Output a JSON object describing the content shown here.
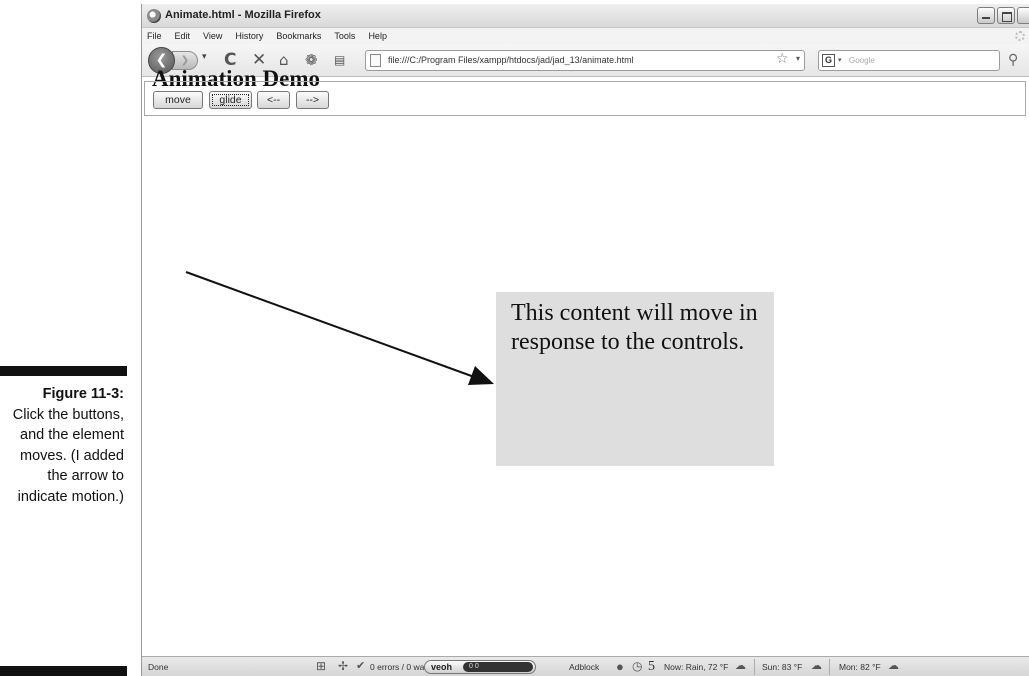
{
  "caption": {
    "figure_number": "Figure 11-3:",
    "text": "Click the buttons, and the element moves. (I added the arrow to indicate motion.)"
  },
  "window": {
    "title": "Animate.html - Mozilla Firefox"
  },
  "menu": {
    "items": [
      "File",
      "Edit",
      "View",
      "History",
      "Bookmarks",
      "Tools",
      "Help"
    ]
  },
  "navigation": {
    "back_glyph": "❮",
    "forward_glyph": "❯",
    "url": "file:///C:/Program Files/xampp/htdocs/jad/jad_13/animate.html",
    "search_engine_letter": "G",
    "search_placeholder": "Google"
  },
  "page": {
    "heading": "Animation Demo",
    "buttons": [
      {
        "label": "move",
        "focused": false
      },
      {
        "label": "glide",
        "focused": true
      },
      {
        "label": "<--",
        "focused": false
      },
      {
        "label": "-->",
        "focused": false
      }
    ],
    "box_text": "This content will move in response to the controls.",
    "box_color": "#dedede"
  },
  "statusbar": {
    "status": "Done",
    "errors": "0 errors / 0 warnings",
    "veoh_label": "veoh",
    "veoh_counts": "0   0",
    "adblock": "Adblock",
    "counter": "5",
    "weather_now": "Now: Rain, 72 °F",
    "weather_sun": "Sun: 83 °F",
    "weather_mon": "Mon: 82 °F"
  }
}
